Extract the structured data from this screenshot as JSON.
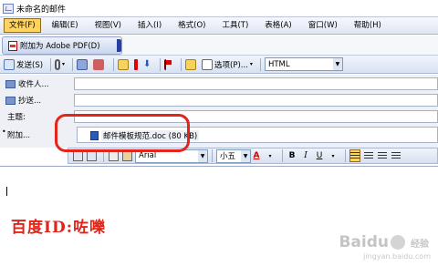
{
  "window": {
    "title": "未命名的邮件"
  },
  "menubar": {
    "items": [
      "文件(F)",
      "编辑(E)",
      "视图(V)",
      "插入(I)",
      "格式(O)",
      "工具(T)",
      "表格(A)",
      "窗口(W)",
      "帮助(H)"
    ]
  },
  "pdf_toolbar": {
    "label": "附加为 Adobe PDF(D)"
  },
  "send_toolbar": {
    "send_label": "发送(S)",
    "options_label": "选项(P)...",
    "format_value": "HTML"
  },
  "headers": {
    "to_label": "收件人...",
    "cc_label": "抄送...",
    "subject_label": "主题:",
    "attach_label": "附加...",
    "attachment_name": "邮件模板规范.doc (80 KB)"
  },
  "format_toolbar": {
    "font": "Arial",
    "size": "小五",
    "color_label": "A",
    "bold_label": "B",
    "italic_label": "I",
    "underline_label": "U"
  },
  "body": {
    "text": "百度ID:咗嚛"
  },
  "watermark": {
    "text": "Baidu",
    "suffix": "经验",
    "url": "jingyan.baidu.com"
  },
  "colors": {
    "highlight": "#e2241b",
    "body_text": "#e02418",
    "menu_active": "#ffd35c"
  }
}
